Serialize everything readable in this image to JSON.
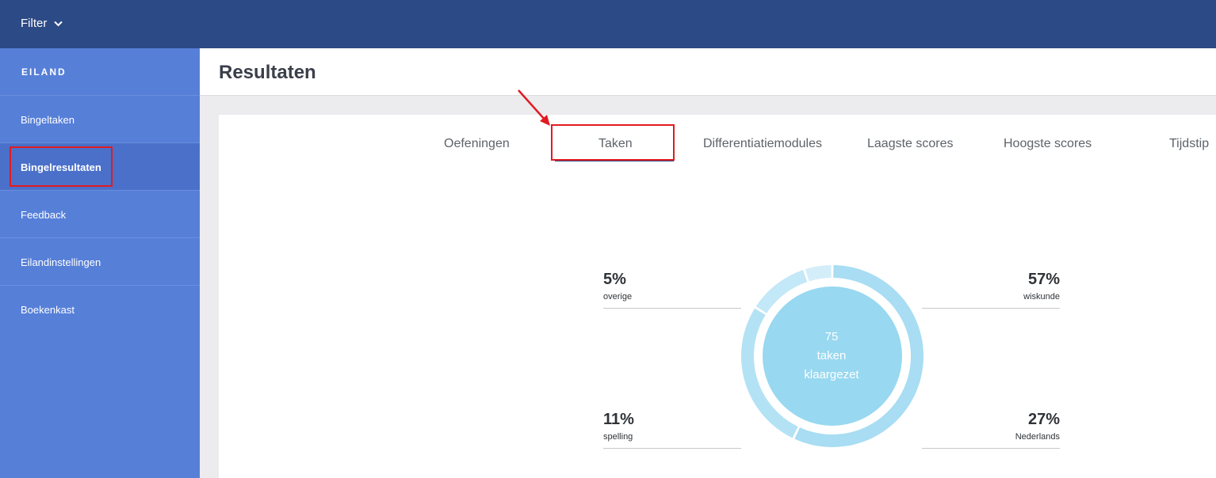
{
  "topbar": {
    "filter_label": "Filter"
  },
  "sidebar": {
    "header": "EILAND",
    "items": [
      {
        "label": "Bingeltaken"
      },
      {
        "label": "Bingelresultaten"
      },
      {
        "label": "Feedback"
      },
      {
        "label": "Eilandinstellingen"
      },
      {
        "label": "Boekenkast"
      }
    ]
  },
  "main": {
    "title": "Resultaten",
    "tabs": [
      {
        "label": "Oefeningen"
      },
      {
        "label": "Taken"
      },
      {
        "label": "Differentiatiemodules"
      },
      {
        "label": "Laagste scores"
      },
      {
        "label": "Hoogste scores"
      },
      {
        "label": "Tijdstip"
      }
    ],
    "active_tab": "Taken"
  },
  "chart_data": {
    "type": "pie",
    "center": {
      "count": "75",
      "line1": "taken",
      "line2": "klaargezet"
    },
    "slices": [
      {
        "label": "wiskunde",
        "value": 57,
        "display": "57%"
      },
      {
        "label": "Nederlands",
        "value": 27,
        "display": "27%"
      },
      {
        "label": "spelling",
        "value": 11,
        "display": "11%"
      },
      {
        "label": "overige",
        "value": 5,
        "display": "5%"
      }
    ]
  },
  "colors": {
    "topbar": "#2c4a85",
    "sidebar": "#567fd8",
    "sidebar_active": "#4a70c9",
    "highlight": "#e11b22",
    "ring": "#a8ddf3",
    "center": "#98d8f0"
  }
}
